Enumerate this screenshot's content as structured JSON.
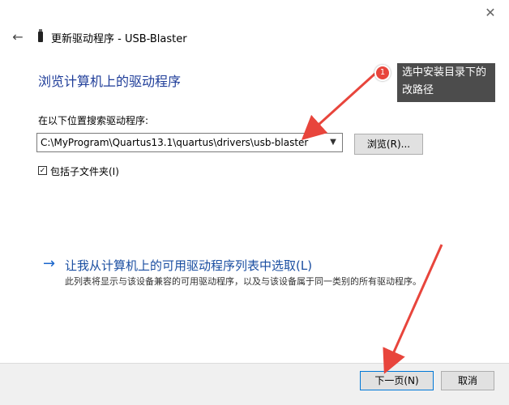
{
  "window": {
    "title": "更新驱动程序 - USB-Blaster",
    "close_icon": "✕",
    "back_icon": "←"
  },
  "main": {
    "heading": "浏览计算机上的驱动程序",
    "search_label": "在以下位置搜索驱动程序:",
    "path_value": "C:\\MyProgram\\Quartus13.1\\quartus\\drivers\\usb-blaster",
    "browse_label": "浏览(R)...",
    "include_subfolders_label": "包括子文件夹(I)",
    "include_subfolders_checked": "☑",
    "link_arrow": "→",
    "link_text": "让我从计算机上的可用驱动程序列表中选取(L)",
    "link_desc": "此列表将显示与该设备兼容的可用驱动程序，以及与该设备属于同一类别的所有驱动程序。"
  },
  "footer": {
    "next_label": "下一页(N)",
    "cancel_label": "取消"
  },
  "annotation": {
    "badge": "1",
    "text": "选中安装目录下的改路径"
  },
  "colors": {
    "heading": "#1f3d99",
    "link": "#1a4ea1",
    "annotation_arrow": "#e8453c",
    "annotation_box": "#4c4c4c"
  }
}
